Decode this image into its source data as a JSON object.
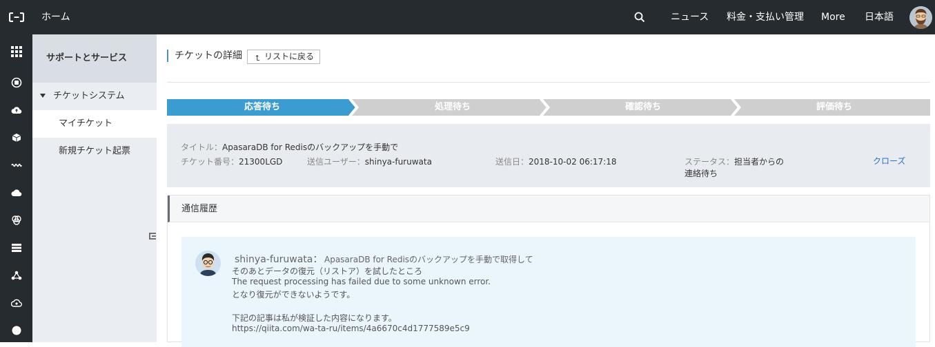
{
  "topbar": {
    "logo_icon": "alibaba-cloud-logo",
    "home_label": "ホーム",
    "links": [
      "ニュース",
      "料金・支払い管理",
      "More",
      "日本語"
    ]
  },
  "rail": {
    "icons": [
      "grid-icon",
      "database-icon",
      "cloud-upload-icon",
      "cube-icon",
      "wave-icon",
      "cloud-icon",
      "circles-icon",
      "list-icon",
      "network-icon",
      "cloud-gear-icon",
      "circle-icon"
    ]
  },
  "sidebar": {
    "header": "サポートとサービス",
    "group_label": "チケットシステム",
    "items": [
      {
        "label": "マイチケット",
        "active": true
      },
      {
        "label": "新規チケット起票",
        "active": false
      }
    ]
  },
  "main": {
    "title": "チケットの詳細",
    "back_button": "リストに戻る",
    "steps": [
      {
        "label": "応答待ち",
        "active": true
      },
      {
        "label": "処理待ち",
        "active": false
      },
      {
        "label": "確認待ち",
        "active": false
      },
      {
        "label": "評価待ち",
        "active": false
      }
    ],
    "colors": {
      "step_active": "#3a9cd0",
      "step_inactive": "#cfcfcf",
      "accent": "#2a6fc9"
    }
  },
  "ticket": {
    "title_label": "タイトル：",
    "title_value": "ApasaraDB for Redisのバックアップを手動で",
    "number_label": "チケット番号：",
    "number_value": "21300LGD",
    "user_label": "送信ユーザー：",
    "user_value": "shinya-furuwata",
    "date_label": "送信日：",
    "date_value": "2018-10-02 06:17:18",
    "status_label": "ステータス：",
    "status_value_1": "担当者からの",
    "status_value_2": "連絡待ち",
    "close_link": "クローズ"
  },
  "history": {
    "header": "通信履歴",
    "message": {
      "author": "shinya-furuwata：",
      "line1": "ApasaraDB for Redisのバックアップを手動で取得して",
      "line2": "そのあとデータの復元（リストア）を試したところ",
      "line3": "The request processing has failed due to some unknown error.",
      "line4": "となり復元ができないようです。",
      "line5": "下記の記事は私が検証した内容になります。",
      "line6": "https://qiita.com/wa-ta-ru/items/4a6670c4d1777589e5c9"
    }
  }
}
